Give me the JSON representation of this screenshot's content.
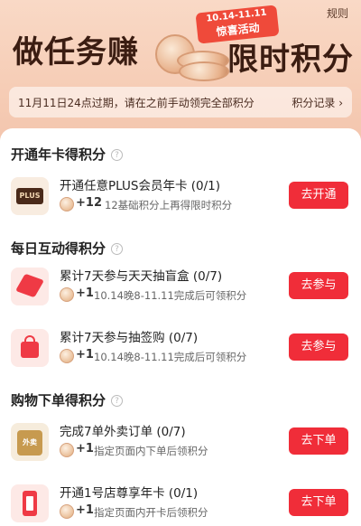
{
  "banner": {
    "rules": "规则",
    "title_left": "做任务赚",
    "title_right": "限时积分",
    "badge_dates": "10.14-11.11",
    "badge_label": "惊喜活动",
    "notice": "11月11日24点过期，请在之前手动领完全部积分",
    "notice_link": "积分记录 ›"
  },
  "sections": [
    {
      "title": "开通年卡得积分"
    },
    {
      "title": "每日互动得积分"
    },
    {
      "title": "购物下单得积分"
    }
  ],
  "help_glyph": "?",
  "tasks": [
    {
      "icon": "plus-card-icon",
      "icon_text": "PLUS",
      "title": "开通任意PLUS会员年卡 (0/1)",
      "reward": "+12",
      "desc": "12基础积分上再得限时积分",
      "button": "去开通"
    },
    {
      "icon": "gift-box-icon",
      "title": "累计7天参与天天抽盲盒 (0/7)",
      "reward": "+1",
      "desc": "10.14晚8-11.11完成后可领积分",
      "button": "去参与"
    },
    {
      "icon": "shopping-bag-icon",
      "title": "累计7天参与抽签购 (0/7)",
      "reward": "+1",
      "desc": "10.14晚8-11.11完成后可领积分",
      "button": "去参与"
    },
    {
      "icon": "takeout-icon",
      "icon_text": "外卖",
      "title": "完成7单外卖订单 (0/7)",
      "reward": "+1",
      "desc": "指定页面内下单后领积分",
      "button": "去下单"
    },
    {
      "icon": "store-card-icon",
      "title": "开通1号店尊享年卡 (0/1)",
      "reward": "+1",
      "desc": "指定页面内开卡后领积分",
      "button": "去下单"
    }
  ],
  "colors": {
    "accent": "#f02d39",
    "banner_bg": "#f6cdb6",
    "title": "#3b1d12"
  }
}
